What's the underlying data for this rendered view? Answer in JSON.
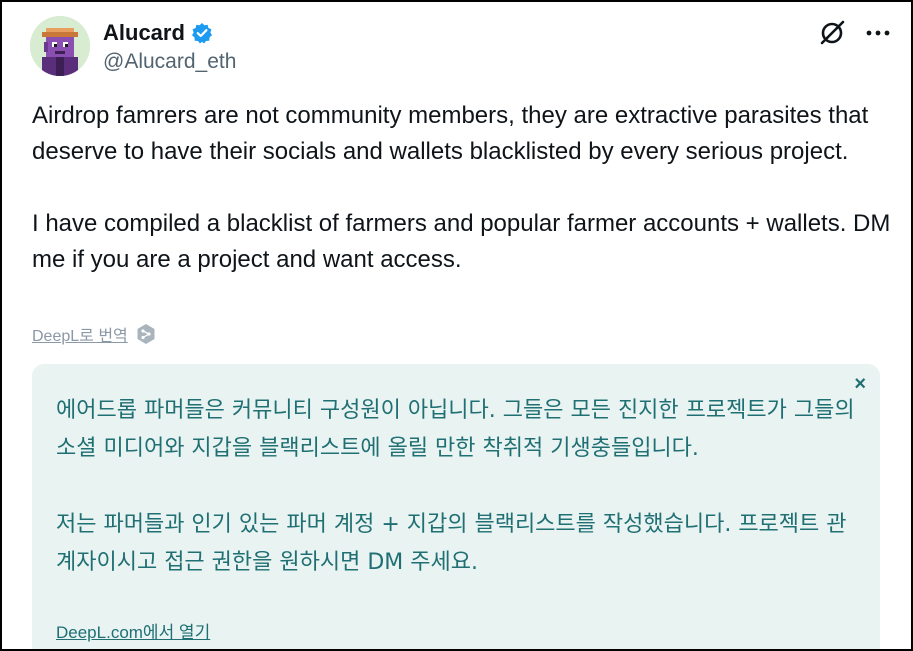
{
  "colors": {
    "text": "#0f1419",
    "muted": "#536471",
    "verified": "#1d9bf0",
    "translation_bg": "#e8f3f2",
    "translation_text": "#1f6f73"
  },
  "author": {
    "display_name": "Alucard",
    "handle": "@Alucard_eth",
    "verified_icon": "verified-badge-icon",
    "avatar": "pixel-art-avatar"
  },
  "header_actions": {
    "grok_icon": "grok-icon",
    "more_icon": "more-options-icon"
  },
  "tweet": {
    "paragraph1": "Airdrop famrers are not community members, they are extractive parasites that deserve to have their socials and wallets blacklisted by every serious project.",
    "paragraph2": "I have compiled a blacklist of farmers and popular farmer accounts + wallets. DM me if you are a project and want access."
  },
  "translation": {
    "translate_link": "DeepL로 번역",
    "deepl_icon": "deepl-icon",
    "close_icon": "close-icon",
    "close_glyph": "×",
    "paragraph1": "에어드롭 파머들은 커뮤니티 구성원이 아닙니다. 그들은 모든 진지한 프로젝트가 그들의 소셜 미디어와 지갑을 블랙리스트에 올릴 만한 착취적 기생충들입니다.",
    "paragraph2": "저는 파머들과 인기 있는 파머 계정 + 지갑의 블랙리스트를 작성했습니다. 프로젝트 관계자이시고 접근 권한을 원하시면 DM 주세요.",
    "open_link": "DeepL.com에서 열기"
  }
}
